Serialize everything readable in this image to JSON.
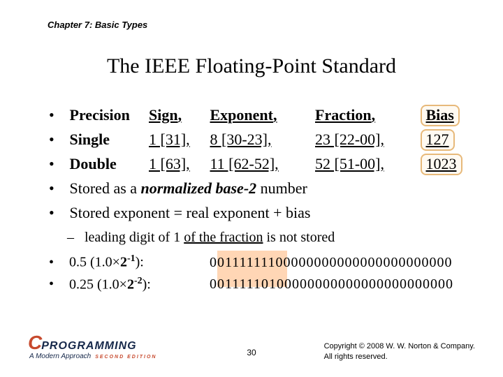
{
  "chapter_label": "Chapter 7: Basic Types",
  "title": "The IEEE Floating-Point Standard",
  "headers": {
    "precision": "Precision",
    "sign": "Sign",
    "exponent": "Exponent",
    "fraction": "Fraction",
    "bias": "Bias"
  },
  "rows": [
    {
      "precision": "Single",
      "sign": "1 [31]",
      "exponent": "8 [30-23]",
      "fraction": "23 [22-00]",
      "bias": "127"
    },
    {
      "precision": "Double",
      "sign": "1 [63]",
      "exponent": "11 [62-52]",
      "fraction": "52 [51-00]",
      "bias": "1023"
    }
  ],
  "extra_bullets": {
    "stored_as_pre": "Stored as a ",
    "stored_as_em": "normalized base-2",
    "stored_as_post": " number",
    "bias_line": "Stored exponent = real exponent + bias"
  },
  "sub": {
    "leading_pre": "leading digit of 1 ",
    "leading_u": "of the fraction",
    "leading_post": " is not stored"
  },
  "examples": [
    {
      "label_pre": "0.5 (1.0×",
      "label_pow": "2",
      "label_exp": "-1",
      "label_post": "):",
      "bits": "00111111100000000000000000000000"
    },
    {
      "label_pre": "0.25 (1.0×",
      "label_pow": "2",
      "label_exp": "-2",
      "label_post": "):",
      "bits": "00111110100000000000000000000000"
    }
  ],
  "page_num": "30",
  "copyright": {
    "l1": "Copyright © 2008 W. W. Norton & Company.",
    "l2": "All rights reserved."
  },
  "logo": {
    "c": "C",
    "prog": "PROGRAMMING",
    "sub": "A Modern Approach",
    "edition": "SECOND EDITION"
  }
}
